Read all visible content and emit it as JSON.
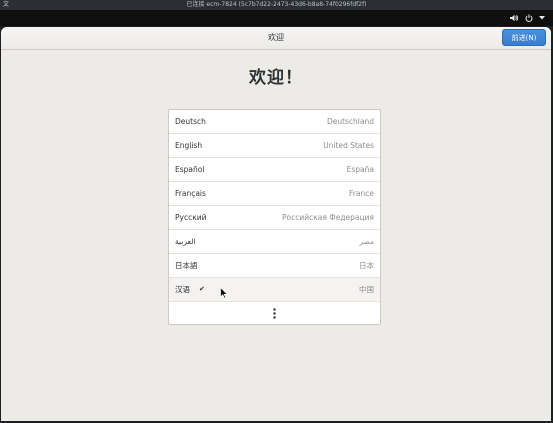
{
  "vm": {
    "left_text": "文",
    "title": "已连接 ecm-7824 (5c7b7d22-2473-43d6-b8a8-74f0296fdf2f)"
  },
  "header": {
    "title": "欢迎",
    "next_label": "前进(N)"
  },
  "welcome": {
    "heading": "欢迎！"
  },
  "languages": [
    {
      "name": "Deutsch",
      "region": "Deutschland",
      "selected": false
    },
    {
      "name": "English",
      "region": "United States",
      "selected": false
    },
    {
      "name": "Español",
      "region": "España",
      "selected": false
    },
    {
      "name": "Français",
      "region": "France",
      "selected": false
    },
    {
      "name": "Русский",
      "region": "Российская Федерация",
      "selected": false
    },
    {
      "name": "العربية",
      "region": "مصر",
      "selected": false
    },
    {
      "name": "日本語",
      "region": "日本",
      "selected": false
    },
    {
      "name": "汉语",
      "region": "中国",
      "selected": true
    }
  ],
  "icons": {
    "volume": "volume-icon",
    "power": "power-icon",
    "menu_arrow": "dropdown-arrow-icon",
    "check": "checkmark-icon",
    "more": "vertical-ellipsis-icon",
    "cursor": "mouse-pointer-icon"
  },
  "colors": {
    "accent": "#3b7dd0",
    "window_bg": "#edebe8",
    "topbar": "#0f0f10"
  }
}
